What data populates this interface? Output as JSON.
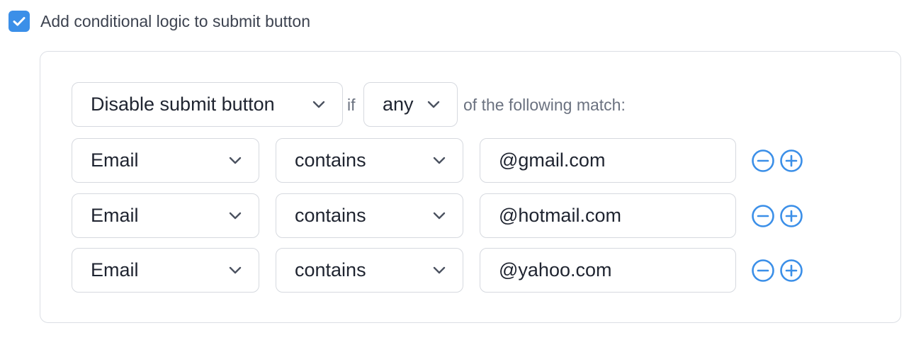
{
  "toggle": {
    "checked": true,
    "label": "Add conditional logic to submit button"
  },
  "rule": {
    "action": "Disable submit button",
    "if_text": "if",
    "match_mode": "any",
    "suffix": "of the following match:"
  },
  "conditions": [
    {
      "field": "Email",
      "operator": "contains",
      "value": "@gmail.com"
    },
    {
      "field": "Email",
      "operator": "contains",
      "value": "@hotmail.com"
    },
    {
      "field": "Email",
      "operator": "contains",
      "value": "@yahoo.com"
    }
  ],
  "icons": {
    "checkbox": "check-icon",
    "dropdown": "chevron-down-icon",
    "remove": "minus-circle-icon",
    "add": "plus-circle-icon"
  },
  "colors": {
    "accent": "#3b8fe8",
    "border": "#d6d9df",
    "muted_text": "#6b7280"
  }
}
